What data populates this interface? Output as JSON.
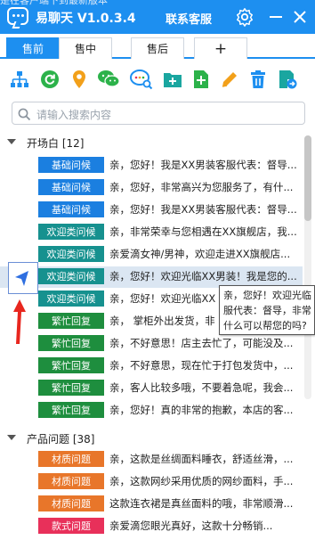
{
  "window": {
    "background_text": "是在客户端下到最新版本",
    "app_title": "易聊天 V1.0.3.4",
    "customer_service": "联系客服",
    "brand_color": "#1d8ff0"
  },
  "tabs": [
    {
      "label": "售前",
      "active": true
    },
    {
      "label": "售中",
      "active": false
    },
    {
      "label": "售后",
      "active": false
    },
    {
      "label": "+",
      "active": false
    }
  ],
  "toolbar": {
    "icons": [
      "org-chart-icon",
      "refresh-icon",
      "location-pin-icon",
      "wechat-icon",
      "chat-search-icon",
      "add-folder-icon",
      "add-file-icon",
      "edit-icon",
      "delete-icon",
      "export-icon"
    ]
  },
  "search": {
    "placeholder": "请输入搜索内容"
  },
  "sections": [
    {
      "title": "开场白 [12]",
      "rows": [
        {
          "tag": "基础问候",
          "color": "#1b7fe0",
          "text": "亲，您好！我是XX男装客服代表：督导..."
        },
        {
          "tag": "基础问候",
          "color": "#1b7fe0",
          "text": "亲，您好，非常高兴为您服务了，有什..."
        },
        {
          "tag": "基础问候",
          "color": "#1b7fe0",
          "text": "亲，您好！我是XX男装客服代表：督导..."
        },
        {
          "tag": "欢迎类问候",
          "color": "#16918f",
          "text": "亲，非常荣幸与您相遇在XX旗舰店，我..."
        },
        {
          "tag": "欢迎类问候",
          "color": "#16918f",
          "text": "亲爱滴女神/男神，欢迎走进XX旗舰店..."
        },
        {
          "tag": "欢迎类问候",
          "color": "#16918f",
          "text": "亲，您好！欢迎光临XX男装！我是您的..."
        },
        {
          "tag": "欢迎类问候",
          "color": "#16918f",
          "text": "亲，您好！欢迎光临XX"
        },
        {
          "tag": "繁忙回复",
          "color": "#1e8e3e",
          "text": "亲，  掌柜外出发货，非"
        },
        {
          "tag": "繁忙回复",
          "color": "#1e8e3e",
          "text": "亲，不好意思！店主去忙了，可能没及..."
        },
        {
          "tag": "繁忙回复",
          "color": "#1e8e3e",
          "text": "亲，不好意思，现在忙于打包发货中，..."
        },
        {
          "tag": "繁忙回复",
          "color": "#1e8e3e",
          "text": "亲，客人比较多哦，不要着急呢，我会..."
        },
        {
          "tag": "繁忙回复",
          "color": "#1e8e3e",
          "text": "亲，您好！真的非常的抱歉，本店的客..."
        }
      ]
    },
    {
      "title": "产品问题 [38]",
      "rows": [
        {
          "tag": "材质问题",
          "color": "#e8762a",
          "text": "亲，这款是丝绸面料睡衣，舒适丝滑，..."
        },
        {
          "tag": "材质问题",
          "color": "#e8762a",
          "text": "亲，这款网纱采用优质的网纱面料，手..."
        },
        {
          "tag": "材质问题",
          "color": "#e8762a",
          "text": "这款连衣裙是真丝面料的哦，非常顺滑..."
        },
        {
          "tag": "款式问题",
          "color": "#e8305a",
          "text": "亲爱滴您眼光真好，这款十分畅销..."
        }
      ]
    }
  ],
  "tooltip": {
    "lines": [
      "亲，您好！欢迎光临",
      "服代表：督导，非常",
      "什么可以帮您的吗?"
    ]
  }
}
